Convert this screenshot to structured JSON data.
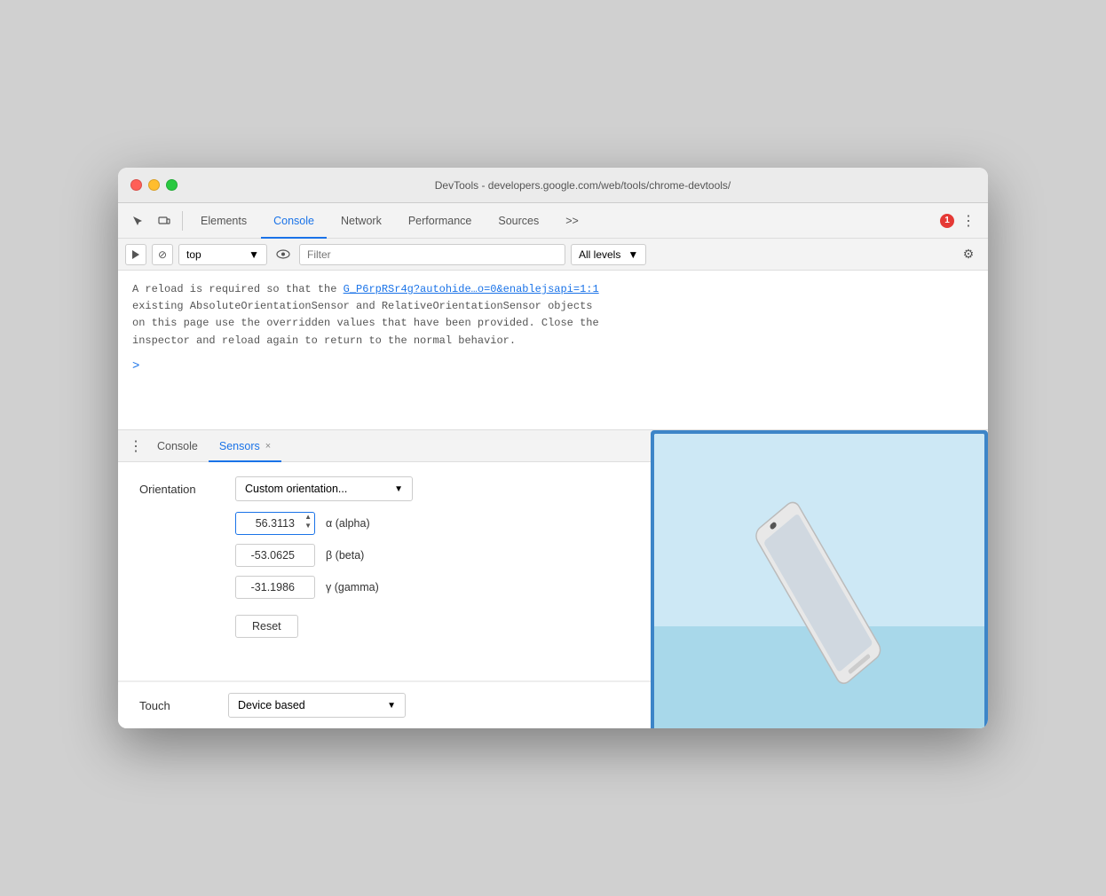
{
  "window": {
    "title": "DevTools - developers.google.com/web/tools/chrome-devtools/"
  },
  "traffic_lights": {
    "red_label": "close",
    "yellow_label": "minimize",
    "green_label": "maximize"
  },
  "toolbar": {
    "tabs": [
      {
        "id": "elements",
        "label": "Elements",
        "active": false
      },
      {
        "id": "console",
        "label": "Console",
        "active": true
      },
      {
        "id": "network",
        "label": "Network",
        "active": false
      },
      {
        "id": "performance",
        "label": "Performance",
        "active": false
      },
      {
        "id": "sources",
        "label": "Sources",
        "active": false
      }
    ],
    "more_label": ">>",
    "error_count": "1",
    "more_icon": "⋮"
  },
  "secondary_toolbar": {
    "run_icon": "▶",
    "block_icon": "⊘",
    "context_value": "top",
    "filter_placeholder": "Filter",
    "levels_label": "All levels",
    "eye_icon": "👁"
  },
  "console_output": {
    "message_line1": "A reload is required so that the",
    "link_text": "G_P6rpRSr4g?autohide…o=0&enablejsapi=1:1",
    "message_line2": "existing AbsoluteOrientationSensor and RelativeOrientationSensor objects",
    "message_line3": "on this page use the overridden values that have been provided. Close the",
    "message_line4": "inspector and reload again to return to the normal behavior.",
    "prompt_symbol": ">"
  },
  "bottom_panel": {
    "tabs": [
      {
        "id": "console",
        "label": "Console",
        "closeable": false
      },
      {
        "id": "sensors",
        "label": "Sensors",
        "closeable": true
      }
    ],
    "close_label": "×"
  },
  "sensors": {
    "orientation_label": "Orientation",
    "dropdown_value": "Custom orientation...",
    "alpha_value": "56.3113",
    "alpha_label": "α (alpha)",
    "beta_value": "-53.0625",
    "beta_label": "β (beta)",
    "gamma_value": "-31.1986",
    "gamma_label": "γ (gamma)",
    "reset_label": "Reset",
    "touch_label": "Touch",
    "touch_dropdown_value": "Device based"
  },
  "icons": {
    "cursor": "↖",
    "mobile": "▣",
    "chevron_down": "▼",
    "gear": "⚙",
    "close": "×",
    "dots": "⋮"
  }
}
